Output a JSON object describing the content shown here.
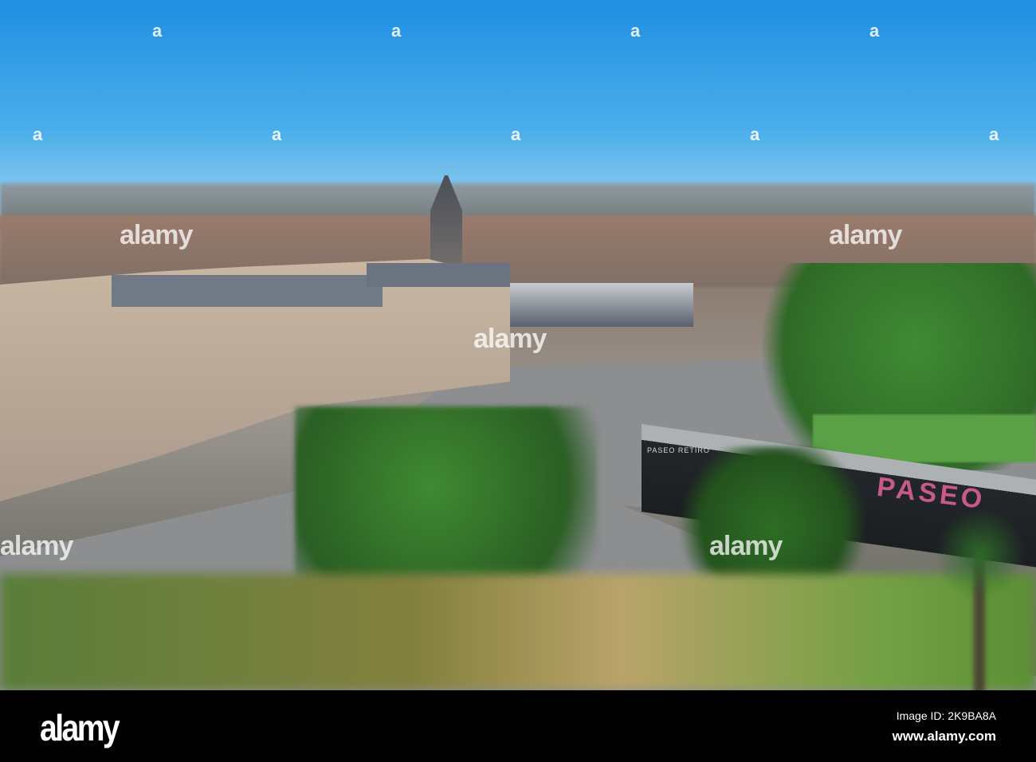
{
  "photo": {
    "description_hidden": null,
    "sign_text": "PASEO RETIRO",
    "sign_letters": "PASEO"
  },
  "watermark": {
    "text": "alamy",
    "glyph": "a"
  },
  "footer": {
    "logo": "alamy",
    "image_id": "Image ID: 2K9BA8A",
    "url": "www.alamy.com"
  }
}
